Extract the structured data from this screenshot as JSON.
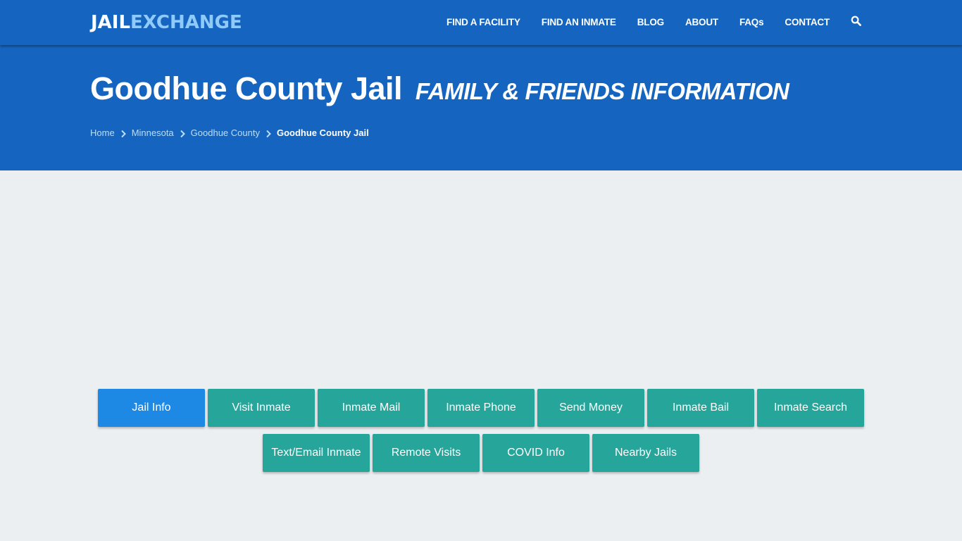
{
  "brand": {
    "logo_part1": "JAIL",
    "logo_part2": "EXCHANGE",
    "colors": {
      "nav_bg": "#1565c0",
      "logo_accent": "#90caf9",
      "page_bg": "#eceff1",
      "button_teal": "#26a69a",
      "button_active": "#1e88e5"
    }
  },
  "nav": {
    "items": [
      {
        "label": "FIND A FACILITY"
      },
      {
        "label": "FIND AN INMATE"
      },
      {
        "label": "BLOG"
      },
      {
        "label": "ABOUT"
      },
      {
        "label": "FAQs"
      },
      {
        "label": "CONTACT"
      }
    ],
    "search_icon": "search-icon"
  },
  "header": {
    "title": "Goodhue County Jail",
    "subtitle": "FAMILY & FRIENDS INFORMATION"
  },
  "breadcrumb": {
    "items": [
      {
        "label": "Home"
      },
      {
        "label": "Minnesota"
      },
      {
        "label": "Goodhue County"
      },
      {
        "label": "Goodhue County Jail"
      }
    ],
    "separator_icon": "chevron-right-icon"
  },
  "tabs": {
    "row1": [
      {
        "label": "Jail Info",
        "active": true
      },
      {
        "label": "Visit Inmate",
        "active": false
      },
      {
        "label": "Inmate Mail",
        "active": false
      },
      {
        "label": "Inmate Phone",
        "active": false
      },
      {
        "label": "Send Money",
        "active": false
      },
      {
        "label": "Inmate Bail",
        "active": false
      },
      {
        "label": "Inmate Search",
        "active": false
      }
    ],
    "row2": [
      {
        "label": "Text/Email Inmate",
        "active": false
      },
      {
        "label": "Remote Visits",
        "active": false
      },
      {
        "label": "COVID Info",
        "active": false
      },
      {
        "label": "Nearby Jails",
        "active": false
      }
    ]
  }
}
